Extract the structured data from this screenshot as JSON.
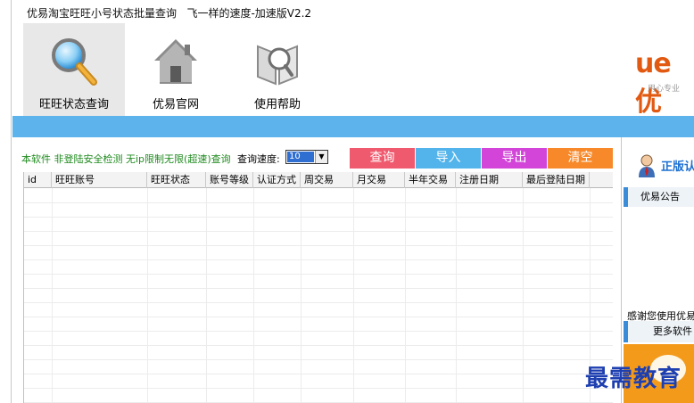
{
  "window": {
    "title": "优易淘宝旺旺小号状态批量查询   飞一样的速度-加速版V2.2"
  },
  "toolbar": {
    "items": [
      {
        "label": "旺旺状态查询",
        "icon": "magnifier-icon"
      },
      {
        "label": "优易官网",
        "icon": "house-icon"
      },
      {
        "label": "使用帮助",
        "icon": "help-book-icon"
      }
    ]
  },
  "logo": {
    "main": "ue 优",
    "sub": "用心专业"
  },
  "controls": {
    "notice": "本软件 非登陆安全检测 无ip限制无限(超速)查询",
    "speed_label": "查询速度:",
    "speed_value": "10",
    "buttons": {
      "query": "查询",
      "import": "导入",
      "export": "导出",
      "clear": "清空"
    },
    "button_colors": {
      "query": "#f05a6e",
      "import": "#52b4ea",
      "export": "#d245d8",
      "clear": "#f7892a"
    }
  },
  "table": {
    "columns": [
      "id",
      "旺旺账号",
      "旺旺状态",
      "账号等级",
      "认证方式",
      "周交易",
      "月交易",
      "半年交易",
      "注册日期",
      "最后登陆日期"
    ],
    "rows": []
  },
  "sidebar": {
    "top_label": "正版认",
    "tab_notice": "优易公告",
    "thanks_text": "感谢您使用优易",
    "more_software": "更多软件"
  },
  "watermark": {
    "text": "最需教育"
  },
  "colors": {
    "accent_bar": "#5db4ec",
    "notice_green": "#1e8a1e",
    "brand_orange": "#e25a12"
  }
}
